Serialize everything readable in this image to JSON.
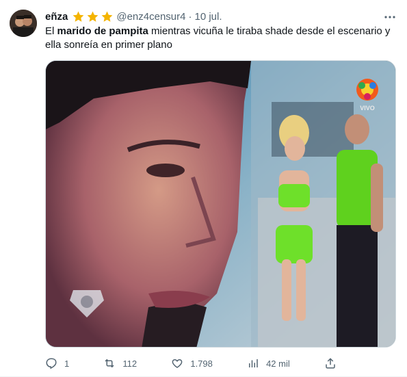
{
  "tweet": {
    "display_name": "eñza",
    "handle": "@enz4censur4",
    "separator": "·",
    "date": "10 jul.",
    "text_before": "El ",
    "text_bold": "marido de pampita",
    "text_after": " mientras vicuña le tiraba shade desde el escenario y ella sonreía en primer plano"
  },
  "media": {
    "overlay_logo_text": "VIVO"
  },
  "actions": {
    "replies": "1",
    "retweets": "112",
    "likes": "1.798",
    "views": "42 mil"
  },
  "icons": {
    "stars": [
      "star-icon",
      "star-icon",
      "star-icon"
    ],
    "more": "more-horizontal-icon",
    "reply": "reply-icon",
    "retweet": "retweet-icon",
    "like": "heart-icon",
    "views": "views-bar-chart-icon",
    "share": "share-icon"
  },
  "colors": {
    "star": "#f4b400",
    "secondary_text": "#536471",
    "primary_text": "#0f1419",
    "outfit_green": "#6ee02a"
  }
}
